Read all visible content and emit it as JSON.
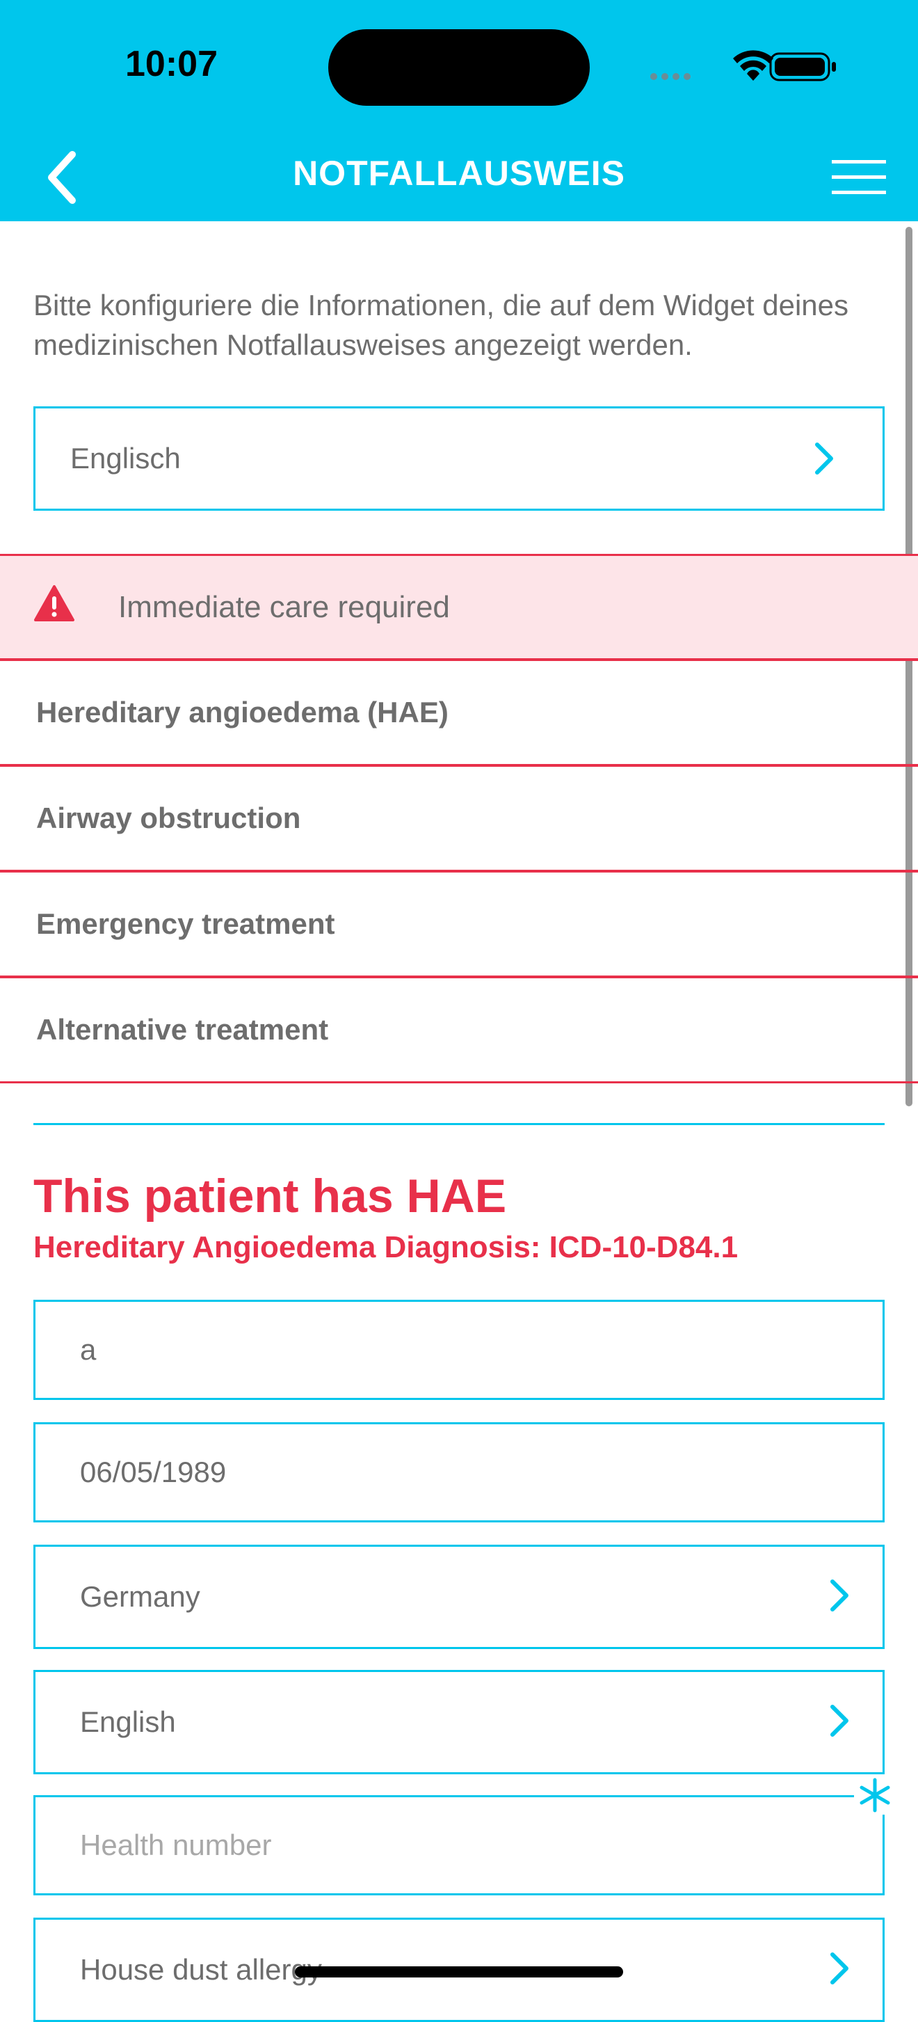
{
  "status_bar": {
    "time": "10:07"
  },
  "nav": {
    "title": "NOTFALLAUSWEIS",
    "back_icon": "chevron-left-icon",
    "menu_icon": "hamburger-menu-icon"
  },
  "intro_text": "Bitte konfiguriere die Informationen, die auf dem Widget deines medizinischen Notfallausweises angezeigt werden.",
  "language_select": {
    "value": "Englisch"
  },
  "alert": {
    "icon": "warning-icon",
    "text": "Immediate care required"
  },
  "sections": [
    {
      "label": "Hereditary angioedema (HAE)"
    },
    {
      "label": "Airway obstruction"
    },
    {
      "label": "Emergency treatment"
    },
    {
      "label": "Alternative treatment"
    }
  ],
  "card": {
    "title": "This patient has HAE",
    "subtitle": "Hereditary Angioedema Diagnosis: ICD-10-D84.1"
  },
  "form": {
    "name_value": "a",
    "birthdate_value": "06/05/1989",
    "country_value": "Germany",
    "language_value": "English",
    "health_number_placeholder": "Health number",
    "allergy_value": "House dust allergy"
  },
  "colors": {
    "accent": "#00c6ec",
    "alert_red": "#e8304a",
    "alert_bg": "#fde4e8",
    "text_gray": "#6d6d6d"
  }
}
